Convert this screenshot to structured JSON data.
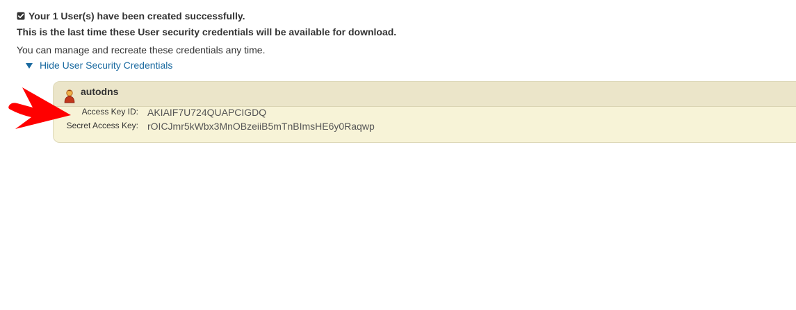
{
  "message": {
    "success": "Your 1 User(s) have been created successfully.",
    "warning": "This is the last time these User security credentials will be available for download.",
    "manage": "You can manage and recreate these credentials any time.",
    "toggle_label": "Hide User Security Credentials"
  },
  "credentials": {
    "username": "autodns",
    "access_key_label": "Access Key ID:",
    "access_key_value": "AKIAIF7U724QUAPCIGDQ",
    "secret_key_label": "Secret Access Key:",
    "secret_key_value": "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"
  },
  "icons": {
    "success": "check-square-icon",
    "toggle": "triangle-down-icon",
    "user": "user-icon",
    "annotation": "red-arrow-icon"
  },
  "colors": {
    "link": "#1a6aa0",
    "panel_bg": "#f7f3d7",
    "panel_header": "#ebe5c9",
    "arrow": "#ff0000"
  }
}
